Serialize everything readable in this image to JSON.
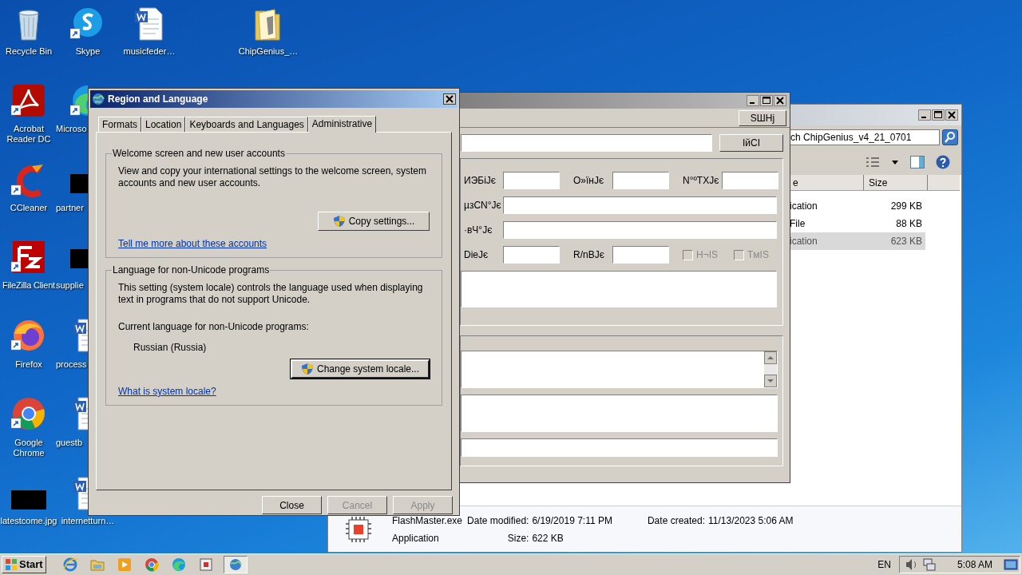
{
  "desktop_icons": [
    {
      "label": "Recycle Bin",
      "kind": "recycle",
      "shortcut": false
    },
    {
      "label": "Skype",
      "kind": "skype",
      "shortcut": true
    },
    {
      "label": "musicfeder…",
      "kind": "word",
      "shortcut": false
    },
    {
      "label": "ChipGenius_…",
      "kind": "folder",
      "shortcut": false
    },
    {
      "label": "Acrobat Reader DC",
      "kind": "acrobat",
      "shortcut": true
    },
    {
      "label": "Microso",
      "kind": "edge",
      "shortcut": true
    },
    {
      "label": "CCleaner",
      "kind": "ccleaner",
      "shortcut": true
    },
    {
      "label": "partner",
      "kind": "thumbnail",
      "shortcut": false
    },
    {
      "label": "FileZilla Client",
      "kind": "filezilla",
      "shortcut": true
    },
    {
      "label": "supplie",
      "kind": "thumbnail",
      "shortcut": false
    },
    {
      "label": "Firefox",
      "kind": "firefox",
      "shortcut": true
    },
    {
      "label": "process",
      "kind": "word",
      "shortcut": false
    },
    {
      "label": "Google Chrome",
      "kind": "chrome",
      "shortcut": true
    },
    {
      "label": "guestb",
      "kind": "word",
      "shortcut": false
    },
    {
      "label": "latestcome.jpg",
      "kind": "thumbnail",
      "shortcut": false
    },
    {
      "label": "internetturn…",
      "kind": "word",
      "shortcut": false
    }
  ],
  "explorer": {
    "search": "ch ChipGenius_v4_21_0701",
    "columns": [
      "e",
      "Size"
    ],
    "rows": [
      {
        "type": "ication",
        "size": "299 KB",
        "selected": false
      },
      {
        "type": "File",
        "size": "88 KB",
        "selected": false
      },
      {
        "type": "ication",
        "size": "623 KB",
        "selected": true
      }
    ],
    "details": {
      "name": "FlashMaster.exe",
      "type": "Application",
      "fields": [
        {
          "label": "Date modified:",
          "value": "6/19/2019 7:11 PM"
        },
        {
          "label": "Date created:",
          "value": "11/13/2023 5:06 AM"
        },
        {
          "label": "Size:",
          "value": "622 KB"
        }
      ]
    }
  },
  "app_window": {
    "top_button": "SШHj",
    "go_button": "IйCI",
    "form_rows": [
      [
        {
          "label": "ИЭБiJє",
          "kind": "field"
        },
        {
          "label": "O»ïнJє",
          "kind": "field"
        },
        {
          "label": "N°ºTXJє",
          "kind": "field"
        }
      ],
      [
        {
          "label": "µзCN°Jє",
          "kind": "wide"
        }
      ],
      [
        {
          "label": "·вЧ°Jє",
          "kind": "wide"
        }
      ],
      [
        {
          "label": "DieJє",
          "kind": "field"
        },
        {
          "label": "R/nBJє",
          "kind": "field"
        },
        {
          "label": "H¬IS",
          "kind": "checkbox",
          "checked": false,
          "disabled": true
        },
        {
          "label": "TмIS",
          "kind": "checkbox",
          "checked": false,
          "disabled": true
        }
      ]
    ]
  },
  "dialog": {
    "title": "Region and Language",
    "tabs": [
      {
        "label": "Formats",
        "selected": false
      },
      {
        "label": "Location",
        "selected": false
      },
      {
        "label": "Keyboards and Languages",
        "selected": false
      },
      {
        "label": "Administrative",
        "selected": true
      }
    ],
    "welcome_group": {
      "title": "Welcome screen and new user accounts",
      "text": "View and copy your international settings to the welcome screen, system accounts and new user accounts.",
      "button": "Copy settings...",
      "link": "Tell me more about these accounts"
    },
    "locale_group": {
      "title": "Language for non-Unicode programs",
      "text": "This setting (system locale) controls the language used when displaying text in programs that do not support Unicode.",
      "current_label": "Current language for non-Unicode programs:",
      "current_value": "Russian (Russia)",
      "button": "Change system locale...",
      "link": "What is system locale?"
    },
    "buttons": [
      {
        "label": "Close",
        "disabled": false
      },
      {
        "label": "Cancel",
        "disabled": true
      },
      {
        "label": "Apply",
        "disabled": true
      }
    ]
  },
  "taskbar": {
    "start": "Start",
    "items": [
      {
        "kind": "ie",
        "active": false
      },
      {
        "kind": "explorer",
        "active": false
      },
      {
        "kind": "media",
        "active": false
      },
      {
        "kind": "chrome",
        "active": false
      },
      {
        "kind": "edge",
        "active": false
      },
      {
        "kind": "app",
        "active": false
      },
      {
        "kind": "globe",
        "active": true
      }
    ],
    "language": "EN",
    "clock": "5:08 AM"
  }
}
